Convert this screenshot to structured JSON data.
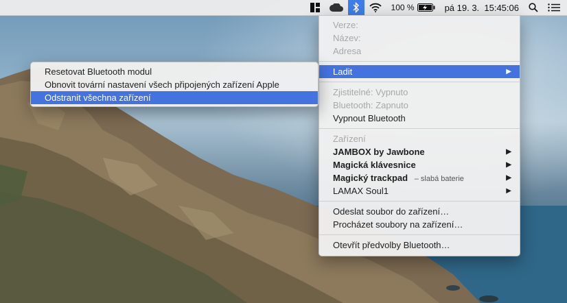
{
  "menubar": {
    "icons": [
      "window-layout-icon",
      "cloud-icon",
      "bluetooth-icon",
      "wifi-icon",
      "battery-charging-icon",
      "search-icon",
      "notification-center-icon"
    ],
    "battery_percent": "100 %",
    "datetime": "pá 19. 3.  15:45:06"
  },
  "bluetooth_menu": {
    "info": {
      "version": "Verze:",
      "name": "Název:",
      "address": "Adresa"
    },
    "debug": "Ladit",
    "status": {
      "discoverable": "Zjistitelné: Vypnuto",
      "bluetooth_state": "Bluetooth: Zapnuto",
      "turn_off": "Vypnout Bluetooth"
    },
    "devices_header": "Zařízení",
    "devices": [
      {
        "name": "JAMBOX by Jawbone",
        "note": ""
      },
      {
        "name": "Magická klávesnice",
        "note": ""
      },
      {
        "name": "Magický trackpad",
        "note": "– slabá baterie"
      },
      {
        "name": "LAMAX Soul1",
        "note": ""
      }
    ],
    "files": {
      "send": "Odeslat soubor do zařízení…",
      "browse": "Procházet soubory na zařízení…"
    },
    "preferences": "Otevřít předvolby Bluetooth…"
  },
  "debug_submenu": {
    "items": [
      "Resetovat Bluetooth modul",
      "Obnovit tovární nastavení všech připojených zařízení Apple",
      "Odstranit všechna zařízení"
    ],
    "highlighted_index": 2
  },
  "colors": {
    "highlight": "#4473e0",
    "menubar_active": "#3f7ee8"
  }
}
